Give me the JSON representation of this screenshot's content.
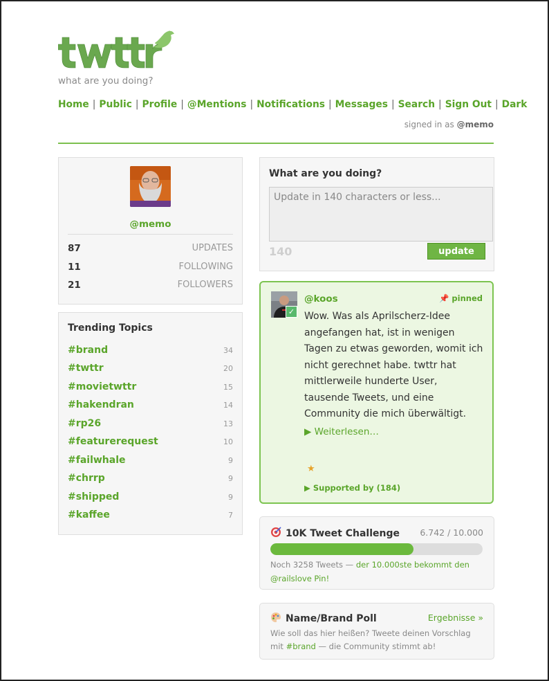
{
  "header": {
    "logo_text": "twttr",
    "tagline": "what are you doing?",
    "signed_in_prefix": "signed in as",
    "signed_in_user": "@memo"
  },
  "nav": [
    "Home",
    "Public",
    "Profile",
    "@Mentions",
    "Notifications",
    "Messages",
    "Search",
    "Sign Out",
    "Dark"
  ],
  "nav_separator": "|",
  "profile": {
    "handle": "@memo",
    "stats": [
      {
        "value": "87",
        "label": "UPDATES"
      },
      {
        "value": "11",
        "label": "FOLLOWING"
      },
      {
        "value": "21",
        "label": "FOLLOWERS"
      }
    ]
  },
  "trending": {
    "title": "Trending Topics",
    "items": [
      {
        "tag": "#brand",
        "count": "34"
      },
      {
        "tag": "#twttr",
        "count": "20"
      },
      {
        "tag": "#movietwttr",
        "count": "15"
      },
      {
        "tag": "#hakendran",
        "count": "14"
      },
      {
        "tag": "#rp26",
        "count": "13"
      },
      {
        "tag": "#featurerequest",
        "count": "10"
      },
      {
        "tag": "#failwhale",
        "count": "9"
      },
      {
        "tag": "#chrrp",
        "count": "9"
      },
      {
        "tag": "#shipped",
        "count": "9"
      },
      {
        "tag": "#kaffee",
        "count": "7"
      }
    ]
  },
  "compose": {
    "title": "What are you doing?",
    "placeholder": "Update in 140 characters or less...",
    "counter": "140",
    "button": "update"
  },
  "pinned_tweet": {
    "user": "@koos",
    "pinned_label": "pinned",
    "text": "Wow. Was als Aprilscherz-Idee angefangen hat, ist in wenigen Tagen zu etwas geworden, womit ich nicht gerechnet habe. twttr hat mittlerweile hunderte User, tausende Tweets, und eine Community die mich überwältigt.",
    "read_more": "▶ Weiterlesen…",
    "star": "★",
    "supported": "▶ Supported by (184)"
  },
  "challenge": {
    "title": "10K Tweet Challenge",
    "progress_text": "6.742 / 10.000",
    "progress_fraction": 0.6742,
    "note_prefix": "Noch 3258 Tweets — ",
    "note_highlight": "der 10.000ste bekommt den @railslove Pin!"
  },
  "poll": {
    "title": "Name/Brand Poll",
    "link": "Ergebnisse »",
    "note_prefix": "Wie soll das hier heißen? Tweete deinen Vorschlag mit ",
    "note_tag": "#brand",
    "note_suffix": " — die Community stimmt ab!"
  },
  "colors": {
    "brand_green": "#5aa52a",
    "divider_green": "#7cbf4e",
    "button_green": "#6fb544",
    "pinned_bg": "#ecf7e2",
    "progress_fill": "#6bb93d"
  }
}
